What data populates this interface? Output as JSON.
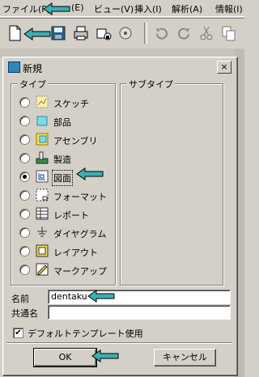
{
  "menubar": {
    "items": [
      "ファイル(F)",
      "(E)",
      "ビュー(V)",
      "挿入(I)",
      "解析(A)",
      "情報(I)"
    ]
  },
  "toolbar": {
    "icons": [
      "new-file-icon",
      "save-icon",
      "print-icon",
      "lock-icon",
      "disk-icon",
      "undo-icon",
      "redo-icon",
      "cut-icon",
      "copy-icon"
    ]
  },
  "dialog": {
    "title": "新規",
    "close": "×",
    "type_label": "タイプ",
    "subtype_label": "サブタイプ",
    "types": [
      {
        "label": "スケッチ",
        "icon": "sketch-icon",
        "selected": false
      },
      {
        "label": "部品",
        "icon": "part-icon",
        "selected": false
      },
      {
        "label": "アセンブリ",
        "icon": "assembly-icon",
        "selected": false
      },
      {
        "label": "製造",
        "icon": "manufacturing-icon",
        "selected": false
      },
      {
        "label": "図面",
        "icon": "drawing-icon",
        "selected": true
      },
      {
        "label": "フォーマット",
        "icon": "format-icon",
        "selected": false
      },
      {
        "label": "レポート",
        "icon": "report-icon",
        "selected": false
      },
      {
        "label": "ダイヤグラム",
        "icon": "diagram-icon",
        "selected": false
      },
      {
        "label": "レイアウト",
        "icon": "layout-icon",
        "selected": false
      },
      {
        "label": "マークアップ",
        "icon": "markup-icon",
        "selected": false
      }
    ],
    "name_label": "名前",
    "name_value": "dentaku",
    "common_name_label": "共通名",
    "common_name_value": "",
    "default_template_label": "デフォルトテンプレート使用",
    "default_template_checked": true,
    "ok_label": "OK",
    "cancel_label": "キャンセル"
  },
  "annotation_color": "#3ab0b3"
}
